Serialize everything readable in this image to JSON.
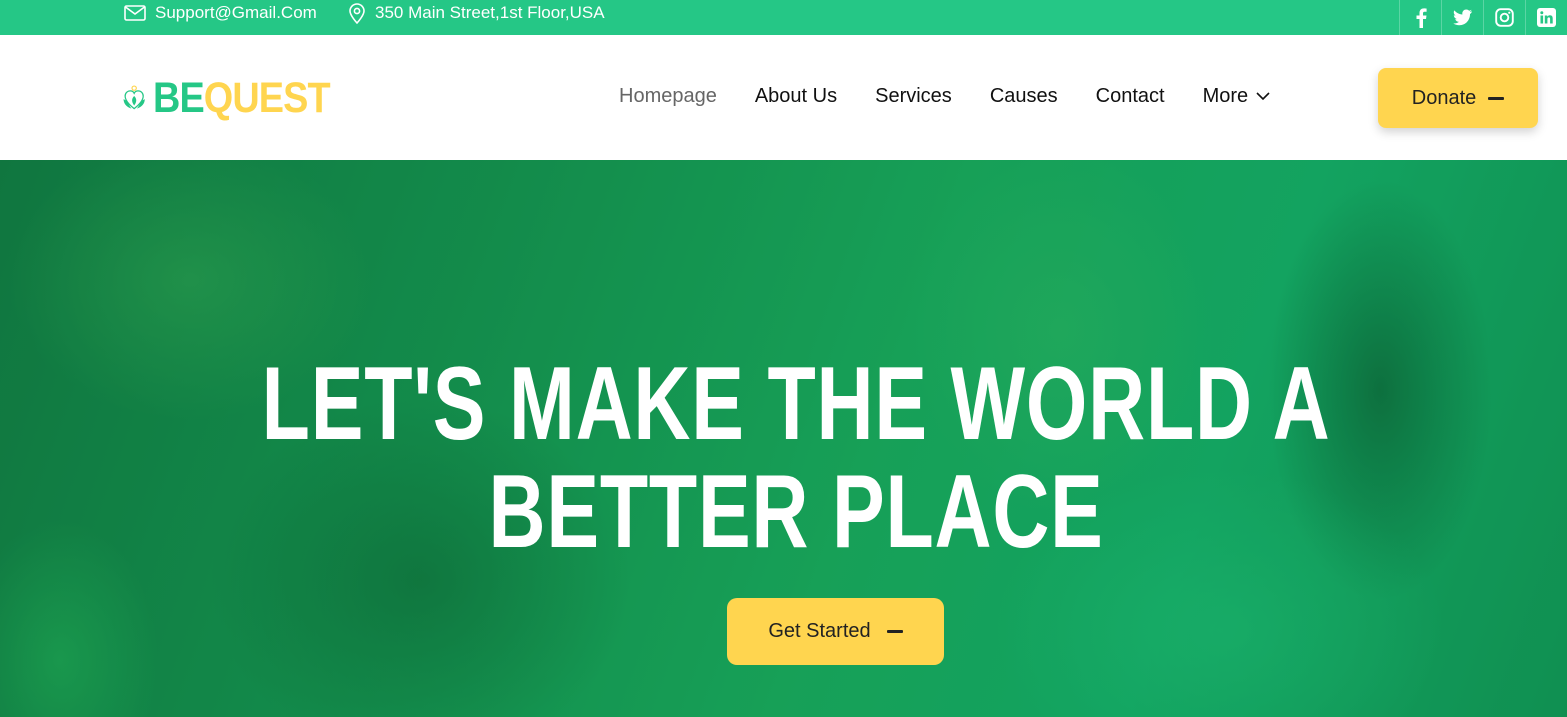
{
  "topbar": {
    "email": "Support@Gmail.Com",
    "address": "350 Main Street,1st Floor,USA",
    "socials": [
      {
        "name": "facebook",
        "icon": "facebook-icon"
      },
      {
        "name": "twitter",
        "icon": "twitter-icon"
      },
      {
        "name": "instagram",
        "icon": "instagram-icon"
      },
      {
        "name": "linkedin",
        "icon": "linkedin-icon"
      }
    ]
  },
  "logo": {
    "part1": "BE",
    "part2": "QUEST"
  },
  "nav": {
    "items": [
      {
        "label": "Homepage",
        "active": true
      },
      {
        "label": "About Us"
      },
      {
        "label": "Services"
      },
      {
        "label": "Causes"
      },
      {
        "label": "Contact"
      },
      {
        "label": "More",
        "dropdown": true
      }
    ]
  },
  "header": {
    "donate_label": "Donate"
  },
  "hero": {
    "title_line1": "LET'S MAKE THE WORLD A",
    "title_line2": "BETTER PLACE",
    "cta_label": "Get Started"
  },
  "colors": {
    "brand_green": "#25c786",
    "accent_yellow": "#ffd54f"
  }
}
